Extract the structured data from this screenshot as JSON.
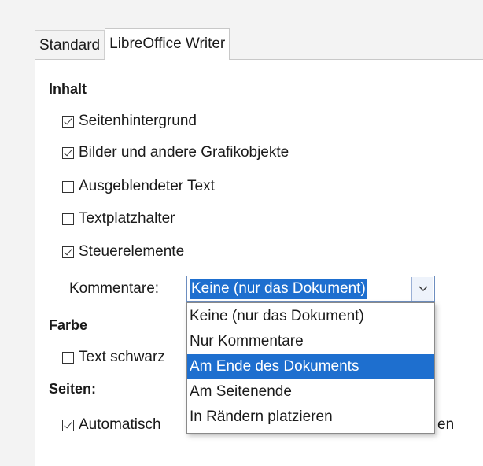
{
  "tabs": [
    "Standard",
    "LibreOffice Writer"
  ],
  "sections": {
    "inhalt": "Inhalt",
    "farbe": "Farbe",
    "seiten": "Seiten:"
  },
  "checkboxes": {
    "seitenhintergrund": {
      "label": "Seitenhintergrund",
      "checked": true
    },
    "bilder": {
      "label": "Bilder und andere Grafikobjekte",
      "checked": true
    },
    "ausgeblendeter": {
      "label": "Ausgeblendeter Text",
      "checked": false
    },
    "textplatzhalter": {
      "label": "Textplatzhalter",
      "checked": false
    },
    "steuerelemente": {
      "label": "Steuerelemente",
      "checked": true
    },
    "text_schwarz": {
      "label": "Text schwarz",
      "checked": false
    },
    "automatisch": {
      "label": "Automatisch",
      "label_tail": "en",
      "checked": true
    }
  },
  "kommentare": {
    "label": "Kommentare:",
    "selected": "Keine (nur das Dokument)",
    "options": [
      "Keine (nur das Dokument)",
      "Nur Kommentare",
      "Am Ende des Dokuments",
      "Am Seitenende",
      "In Rändern platzieren"
    ],
    "highlighted_option": "Am Ende des Dokuments"
  },
  "colors": {
    "selection": "#1e6fcf",
    "panel": "#ffffff",
    "background": "#f3f3f3"
  }
}
